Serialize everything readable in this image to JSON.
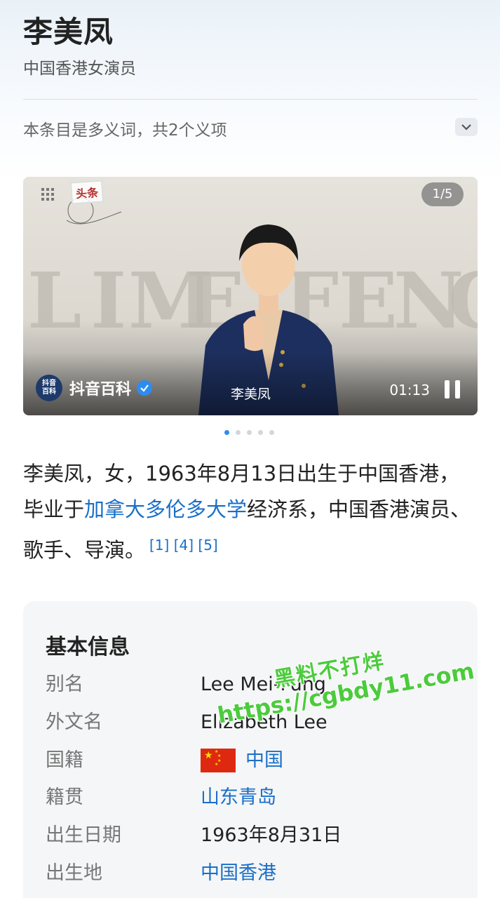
{
  "header": {
    "title": "李美凤",
    "subtitle": "中国香港女演员",
    "disambiguation": "本条目是多义词，共2个义项"
  },
  "media": {
    "badge": "头条",
    "counter": "1/5",
    "background_letters": [
      "L",
      "I",
      "M",
      "E",
      "F",
      "E",
      "N",
      "G"
    ],
    "source_logo_line1": "抖音",
    "source_logo_line2": "百科",
    "source_name": "抖音百科",
    "caption": "李美凤",
    "time": "01:13",
    "dot_count": 5,
    "active_dot": 0
  },
  "intro": {
    "part1": "李美凤，女，1963年8月13日出生于中国香港，毕业于",
    "link": "加拿大多伦多大学",
    "part2": "经济系，中国香港演员、歌手、导演。",
    "refs": "[1] [4] [5]"
  },
  "info": {
    "title": "基本信息",
    "rows": [
      {
        "label": "别名",
        "value": "Lee Mei-Fung",
        "link": false
      },
      {
        "label": "外文名",
        "value": "Elizabeth Lee",
        "link": false
      },
      {
        "label": "国籍",
        "value": "中国",
        "link": true,
        "flag": true
      },
      {
        "label": "籍贯",
        "value": "山东青岛",
        "link": true
      },
      {
        "label": "出生日期",
        "value": "1963年8月31日",
        "link": false
      },
      {
        "label": "出生地",
        "value": "中国香港",
        "link": true
      }
    ]
  },
  "watermark": {
    "line1": "黑料不打烊",
    "line2": "https://cgbdy11.com"
  },
  "colors": {
    "link": "#1a6fc9",
    "accent_dot": "#2d8cf0",
    "flag_red": "#de2910",
    "watermark_green": "#4ccb3d"
  }
}
